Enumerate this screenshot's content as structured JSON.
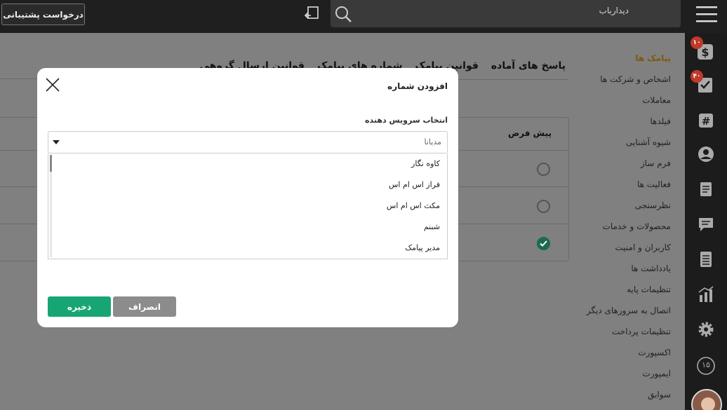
{
  "topbar": {
    "support_label": "درخواست پشتیبانی",
    "search_placeholder": "دیدارباب"
  },
  "rail": {
    "icons": [
      "dollar-icon",
      "task-check-icon",
      "hashtag-icon",
      "user-icon",
      "document-icon",
      "chat-icon",
      "list-icon",
      "chart-icon",
      "gear-icon",
      "numbered-circle-icon"
    ],
    "badges": [
      "۱۰",
      "۴۰"
    ],
    "circle_number": "۱۵"
  },
  "settings_nav": [
    "پیامک ها",
    "اشخاص و شرکت ها",
    "معاملات",
    "فیلدها",
    "شیوه آشنایی",
    "فرم ساز",
    "فعالیت ها",
    "نظرسنجی",
    "محصولات و خدمات",
    "کاربران و امنیت",
    "یادداشت ها",
    "تنظیمات پایه",
    "اتصال به سرورهای دیگر",
    "تنظیمات پرداخت",
    "اکسپورت",
    "ایمپورت",
    "سوابق"
  ],
  "tabs": [
    "پاسخ های آماده",
    "قوانین پیامک",
    "شماره های پیامک",
    "قوانین ارسال گروهی"
  ],
  "table": {
    "default_col": "پیش فرض",
    "rows_default": [
      false,
      false,
      true
    ]
  },
  "modal": {
    "title": "افزودن شماره",
    "field_label": "انتخاب سرویس دهنده",
    "selected_value": "مدیانا",
    "options": [
      "کاوه نگار",
      "فراز اس ام اس",
      "مکث اس ام اس",
      "شبنم",
      "مدیر پیامک"
    ],
    "save_label": "ذخیره",
    "cancel_label": "انصراف"
  },
  "colors": {
    "save": "#17a673",
    "cancel": "#8c8c8c",
    "active_nav": "#7d5a0a",
    "badge": "#c0392b"
  }
}
